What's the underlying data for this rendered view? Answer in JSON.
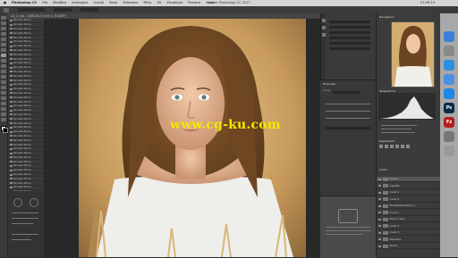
{
  "menubar": {
    "items": [
      "Photoshop CC",
      "File",
      "Modifica",
      "Immagine",
      "Livello",
      "Testo",
      "Seleziona",
      "Filtro",
      "3D",
      "Visualizza",
      "Finestra",
      "Aiuto"
    ],
    "app_title": "Adobe Photoshop CC 2017",
    "clock": "21:09:19"
  },
  "document_tab": {
    "label": "12_1_cap... 8/48.8% (Curve 1, RGB/8*)"
  },
  "history": {
    "items": [
      "Pennello Storia",
      "Pennello Storia",
      "Pennello Storia",
      "Pennello Storia",
      "Pennello Storia",
      "Pennello Storia",
      "Pennello Storia",
      "Pennello Storia",
      "Pennello Storia",
      "Pennello Storia",
      "Pennello Storia",
      "Pennello Storia",
      "Pennello Storia",
      "Pennello Storia",
      "Pennello Storia",
      "Pennello Storia",
      "Pennello Storia",
      "Pennello Storia",
      "Pennello Storia",
      "Pennello Storia",
      "Pennello Storia",
      "Pennello Storia",
      "Pennello Storia",
      "Pennello Storia",
      "Pennello Storia",
      "Pennello Storia",
      "Pennello Storia",
      "Pennello Storia",
      "Pennello Storia",
      "Pennello Storia",
      "Pennello Storia",
      "Pennello Storia",
      "Pennello Storia",
      "Pennello Storia",
      "Pennello Storia",
      "Pennello Storia",
      "Pennello Storia",
      "Pennello Storia",
      "Pennello Storia",
      "Pennello Storia",
      "Pennello Storia",
      "Pennello Storia",
      "Pennello Storia",
      "Pennello Storia",
      "Nuovo livello",
      "Pennello Storia",
      "Pennello Storia",
      "Pennello Storia"
    ]
  },
  "canvas": {
    "watermark": "www.cg-ku.com"
  },
  "properties": {
    "title": "Proprietà",
    "subtitle": "Curve"
  },
  "right_panel": {
    "navigator_title": "Navigatore",
    "histogram_title": "Istogramma",
    "adjustments_title": "Regolazioni",
    "layers_title": "Livelli",
    "layers": [
      "Curve 1",
      "Vignetta",
      "Livello 1",
      "Livello 2",
      "Tonalità/saturazione 1",
      "Curve 2",
      "Sfondo copia",
      "Livello 3",
      "Livello 4",
      "Maschera",
      "Sfondo"
    ]
  },
  "dock": {
    "icons": [
      "finder-icon",
      "launchpad-icon",
      "safari-icon",
      "mail-icon",
      "appstore-icon",
      "photoshop-icon",
      "filezilla-icon",
      "preferences-icon",
      "trash-icon"
    ],
    "labels": [
      "",
      "",
      "",
      "",
      "",
      "Ps",
      "Fz",
      "",
      ""
    ],
    "colors": [
      "#3d7fd9",
      "#8a8a8a",
      "#2a8fe0",
      "#4a90e2",
      "#1e88e5",
      "#0b2a4a",
      "#b71c1c",
      "#777777",
      "#999999"
    ]
  }
}
